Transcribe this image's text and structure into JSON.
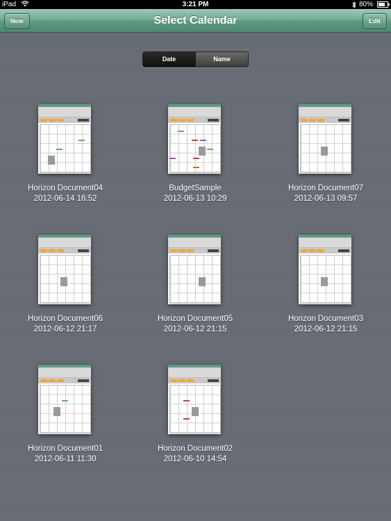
{
  "statusbar": {
    "device": "iPad",
    "time": "3:21 PM",
    "battery": "80%",
    "icons": [
      "wifi-icon",
      "bluetooth-icon",
      "battery-icon"
    ]
  },
  "navbar": {
    "title": "Select Calendar",
    "new_label": "New",
    "edit_label": "Edit",
    "color": "#6fa890"
  },
  "sort": {
    "options": [
      "Date",
      "Name"
    ],
    "selected": "Date"
  },
  "documents": [
    {
      "name": "Horizon Document04",
      "date": "2012-06-14 16:52"
    },
    {
      "name": "BudgetSample",
      "date": "2012-06-13 10:29"
    },
    {
      "name": "Horizon Document07",
      "date": "2012-06-13 09:57"
    },
    {
      "name": "Horizon Document06",
      "date": "2012-06-12 21:17"
    },
    {
      "name": "Horizon Document05",
      "date": "2012-06-12 21:15"
    },
    {
      "name": "Horizon Document03",
      "date": "2012-06-12 21:15"
    },
    {
      "name": "Horizon Document01",
      "date": "2012-06-11 11:30"
    },
    {
      "name": "Horizon Document02",
      "date": "2012-06-10 14:54"
    }
  ]
}
